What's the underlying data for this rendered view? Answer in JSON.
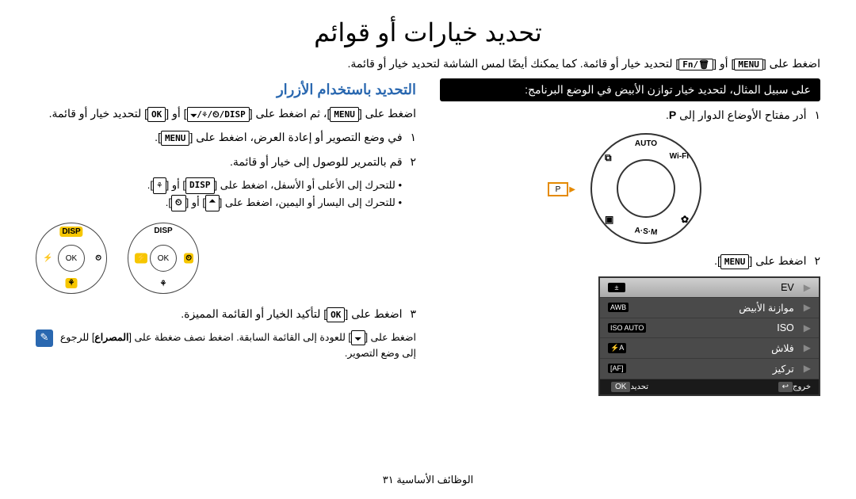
{
  "title": "تحديد خيارات أو قوائم",
  "intro_prefix": "اضغط على ",
  "intro_mid": " أو ",
  "intro_suffix": " لتحديد خيار أو قائمة. كما يمكنك أيضًا لمس الشاشة لتحديد خيار أو قائمة.",
  "btn": {
    "menu": "MENU",
    "fn": "Fn/🗑",
    "ok": "OK",
    "disp": "DISP",
    "shutter": "المصراع",
    "multi": "🞃/⚘/⏲/DISP",
    "flower": "⚘",
    "up": "🞁",
    "down": "🞃",
    "timer": "⏲"
  },
  "right": {
    "section": "التحديد باستخدام الأزرار",
    "para1_a": "اضغط على ",
    "para1_b": "، ثم اضغط على ",
    "para1_c": " أو ",
    "para1_d": " لتحديد خيار أو قائمة.",
    "step1_a": "في وضع التصوير أو إعادة العرض، اضغط على ",
    "step1_b": ".",
    "step2": "قم بالتمرير للوصول إلى خيار أو قائمة.",
    "b1_a": "للتحرك إلى الأعلى أو الأسفل، اضغط على ",
    "b1_b": " أو ",
    "b1_c": ".",
    "b2_a": "للتحرك إلى اليسار أو اليمين، اضغط على ",
    "b2_b": " أو ",
    "b2_c": ".",
    "step3_a": "اضغط على ",
    "step3_b": " لتأكيد الخيار أو القائمة المميزة.",
    "note_a": "اضغط على ",
    "note_b": " للعودة إلى القائمة السابقة. اضغط نصف ضغطة على ",
    "note_c": " للرجوع إلى وضع التصوير.",
    "pad_ok": "OK",
    "pad_disp": "DISP"
  },
  "left": {
    "bar": "على سبيل المثال، لتحديد خيار توازن الأبيض في الوضع البرنامج:",
    "step1_a": "أدر مفتاح الأوضاع الدوار إلى ",
    "step1_b": ".",
    "mode_p": "P",
    "dial": {
      "auto": "AUTO",
      "wifi": "Wi-Fi",
      "asm": "A·S·M",
      "scn": "✿",
      "mov": "▣",
      "frame": "⧉"
    },
    "step2_a": "اضغط على ",
    "step2_b": ".",
    "menu": {
      "rows": [
        {
          "label": "EV",
          "icon": "±"
        },
        {
          "label": "موازنة الأبيض",
          "icon": "AWB"
        },
        {
          "label": "ISO",
          "icon": "ISO AUTO"
        },
        {
          "label": "فلاش",
          "icon": "⚡A"
        },
        {
          "label": "تركيز",
          "icon": "[AF]"
        }
      ],
      "foot_exit": "خروج",
      "foot_exit_btn": "↩",
      "foot_sel": "تحديد",
      "foot_sel_btn": "OK"
    }
  },
  "nums": {
    "1": "١",
    "2": "٢",
    "3": "٣"
  },
  "footer": "الوظائف الأساسية  ٣١"
}
